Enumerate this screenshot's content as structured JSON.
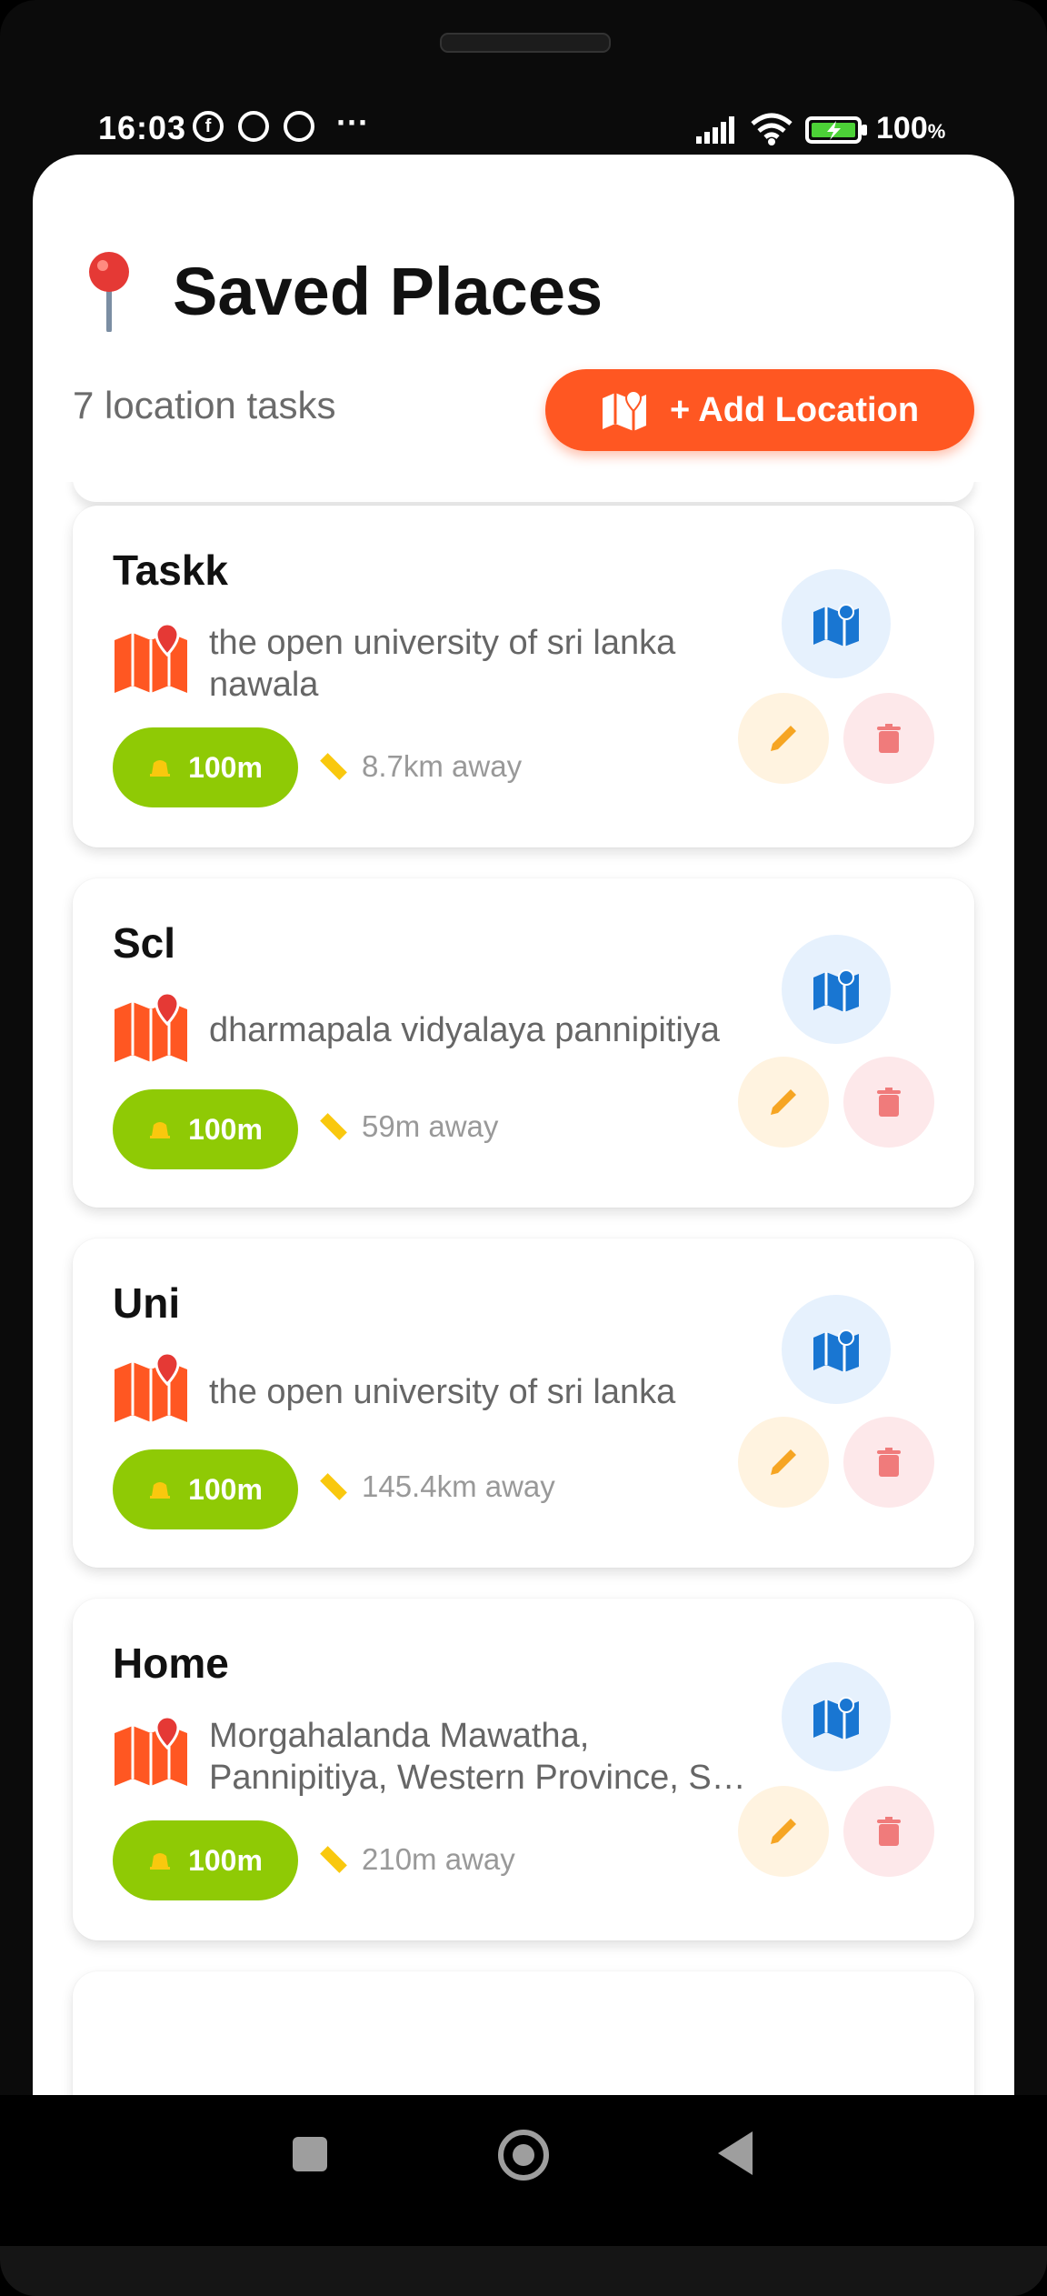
{
  "status_bar": {
    "time": "16:03",
    "battery": "100",
    "battery_unit": "%",
    "notification_icons": [
      "facebook-icon",
      "whatsapp-icon",
      "whatsapp-icon"
    ],
    "overflow": "···"
  },
  "header": {
    "title": "Saved Places",
    "pin_icon": "round-pushpin-icon",
    "subtitle": "7 location tasks",
    "add_button_label": "+ Add Location"
  },
  "colors": {
    "accent": "#ff5722",
    "badge": "#8fca05",
    "map_button_bg": "#e6f1fd",
    "edit_button_bg": "#fff3e0",
    "delete_button_bg": "#fde8ea"
  },
  "locations": [
    {
      "name": "Taskk",
      "address": "the open university of sri lanka nawala",
      "radius": "100m",
      "distance": "8.7km away"
    },
    {
      "name": "Scl",
      "address": "dharmapala vidyalaya pannipitiya",
      "radius": "100m",
      "distance": "59m away"
    },
    {
      "name": "Uni",
      "address": "the open university of sri lanka",
      "radius": "100m",
      "distance": "145.4km away"
    },
    {
      "name": "Home",
      "address": "Morgahalanda Mawatha, Pannipitiya, Western Province, S…",
      "radius": "100m",
      "distance": "210m away"
    }
  ]
}
